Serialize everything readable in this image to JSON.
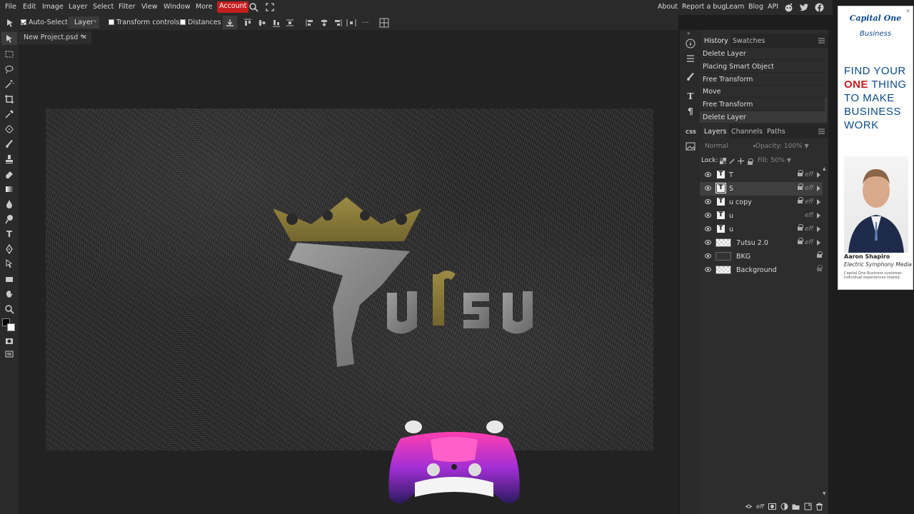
{
  "menu": {
    "items": [
      "File",
      "Edit",
      "Image",
      "Layer",
      "Select",
      "Filter",
      "View",
      "Window",
      "More"
    ],
    "account": "Account",
    "right_items": [
      "About",
      "Report a bug",
      "Learn",
      "Blog",
      "API"
    ]
  },
  "options": {
    "auto_select_label": "Auto-Select",
    "auto_select_checked": true,
    "select_value": "Layer",
    "transform_controls_label": "Transform controls",
    "distances_label": "Distances"
  },
  "document": {
    "tab_title": "New Project.psd *",
    "close_glyph": "✕"
  },
  "artwork": {
    "logo_number": "7",
    "logo_word": "utsu",
    "product": "controller"
  },
  "history_panel": {
    "tabs": [
      "History",
      "Swatches"
    ],
    "items": [
      "Delete Layer",
      "Placing Smart Object",
      "Free Transform",
      "Move",
      "Free Transform",
      "Delete Layer"
    ]
  },
  "layers_panel": {
    "tabs": [
      "Layers",
      "Channels",
      "Paths"
    ],
    "blend_mode": "Normal",
    "opacity_label": "Opacity:",
    "opacity_value": "100%",
    "lock_label": "Lock:",
    "fill_label": "Fill:",
    "fill_value": "50%",
    "layers": [
      {
        "name": "T",
        "kind": "text",
        "locked": true,
        "eff": "eff"
      },
      {
        "name": "S",
        "kind": "text",
        "locked": true,
        "eff": "eff",
        "selected": true
      },
      {
        "name": "u copy",
        "kind": "text",
        "locked": true,
        "eff": "eff"
      },
      {
        "name": "u",
        "kind": "text",
        "locked": false,
        "eff": "eff"
      },
      {
        "name": "u",
        "kind": "text",
        "locked": true,
        "eff": "eff"
      },
      {
        "name": "7utsu 2.0",
        "kind": "smart",
        "locked": true,
        "eff": "eff"
      },
      {
        "name": "BKG",
        "kind": "smart",
        "locked": true,
        "eff": ""
      },
      {
        "name": "Background",
        "kind": "image",
        "locked": true,
        "eff": ""
      }
    ]
  },
  "ad": {
    "brand": "Capital One",
    "brand_sub": "Business",
    "headline_1": "FIND YOUR",
    "headline_em": "ONE",
    "headline_2": "THING TO MAKE BUSINESS WORK",
    "person_name": "Aaron Shapiro",
    "person_company": "Electric Symphony Media",
    "disclaimer": "Capital One Business customer. Individual experiences shared.",
    "brand_color": "#0c4a8a",
    "accent_color": "#c41e1e"
  }
}
